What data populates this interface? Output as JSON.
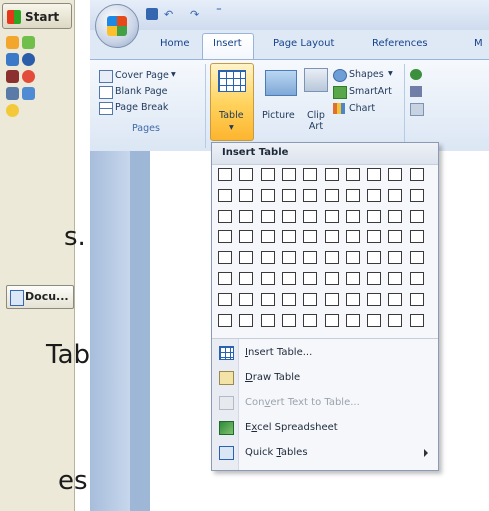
{
  "taskbar": {
    "start_label": "Start",
    "document_button": "Docu..."
  },
  "slide_text": {
    "line1": "s.",
    "line2": "Tab",
    "line3": "es"
  },
  "ribbon": {
    "tabs": [
      "Home",
      "Insert",
      "Page Layout",
      "References",
      "M"
    ],
    "active_tab": "Insert",
    "pages_group": {
      "label": "Pages",
      "items": [
        "Cover Page",
        "Blank Page",
        "Page Break"
      ]
    },
    "table_label": "Table",
    "picture_label": "Picture",
    "clip_art_label": "Clip Art",
    "illustrations": [
      "Shapes",
      "SmartArt",
      "Chart"
    ]
  },
  "insert_table_menu": {
    "title": "Insert Table",
    "grid": {
      "columns": 10,
      "rows": 8
    },
    "items": [
      {
        "pre": "",
        "u": "I",
        "post": "nsert Table...",
        "disabled": false
      },
      {
        "pre": "",
        "u": "D",
        "post": "raw Table",
        "disabled": false
      },
      {
        "pre": "Con",
        "u": "v",
        "post": "ert Text to Table...",
        "disabled": true
      },
      {
        "pre": "E",
        "u": "x",
        "post": "cel Spreadsheet",
        "disabled": false
      },
      {
        "pre": "Quick ",
        "u": "T",
        "post": "ables",
        "disabled": false
      }
    ]
  }
}
